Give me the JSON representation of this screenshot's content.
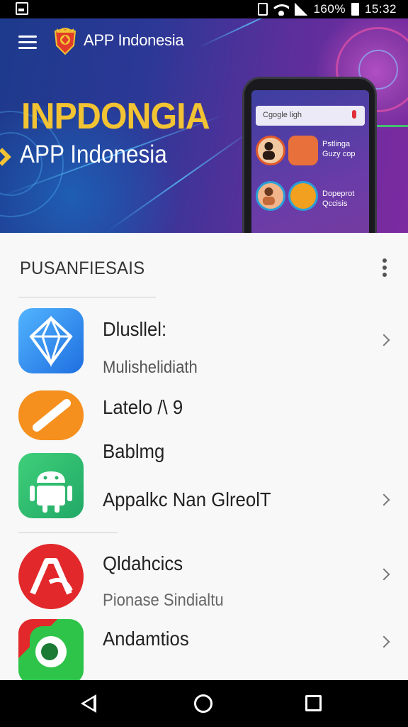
{
  "status_bar": {
    "battery": "160%",
    "time": "15:32",
    "icons": [
      "notification-icon",
      "vibrate-icon",
      "wifi-icon",
      "signal-icon",
      "battery-icon"
    ]
  },
  "header": {
    "brand_name": "APP Indonesia",
    "menu_icon": "hamburger-menu-icon"
  },
  "hero": {
    "title": "INPDONGIA",
    "subtitle": "APP Indonesia",
    "title_color": "#f2c332",
    "phone": {
      "search_placeholder": "Cgogle ligh",
      "item1_line1": "Pstlinga",
      "item1_line2": "Guzy cop",
      "item2_line1": "Dopeprot",
      "item2_line2": "Qccisis"
    }
  },
  "list": {
    "section_title": "PUSANFIESAIS",
    "items": [
      {
        "title": "Dlusllel:",
        "subtitle": "Mulishelidiath",
        "icon": "diamond-app-icon",
        "color": "#2f8df0"
      },
      {
        "title": "Latelo /\\ 9",
        "icon": "pencil-app-icon",
        "color": "#f5901f"
      },
      {
        "title": "Bablmg",
        "subtitle": "Appalkc Nan GlreolT",
        "icon": "android-app-icon",
        "color": "#2fbf71"
      },
      {
        "title": "Qldahcics",
        "subtitle": "Pionase Sindialtu",
        "icon": "red-a-app-icon",
        "color": "#e2282b"
      },
      {
        "title": "Andamtios",
        "icon": "green-chat-app-icon",
        "color": "#2ec44a"
      }
    ]
  },
  "nav": {
    "back": "back-icon",
    "home": "home-icon",
    "recents": "recents-icon"
  }
}
